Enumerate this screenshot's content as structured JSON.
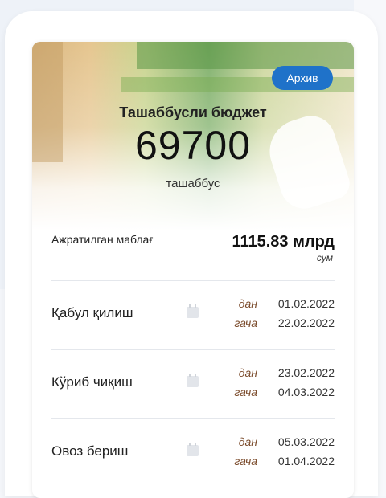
{
  "archive_button": {
    "label": "Архив"
  },
  "hero": {
    "title": "Ташаббусли бюджет",
    "value": "69700",
    "unit": "ташаббус"
  },
  "allocation": {
    "label": "Ажратилган маблағ",
    "value": "1115.83 млрд",
    "unit": "сум"
  },
  "stages": [
    {
      "label": "Қабул қилиш",
      "from_label": "дан",
      "from": "01.02.2022",
      "to_label": "гача",
      "to": "22.02.2022"
    },
    {
      "label": "Кўриб чиқиш",
      "from_label": "дан",
      "from": "23.02.2022",
      "to_label": "гача",
      "to": "04.03.2022"
    },
    {
      "label": "Овоз бериш",
      "from_label": "дан",
      "from": "05.03.2022",
      "to_label": "гача",
      "to": "01.04.2022"
    }
  ],
  "colors": {
    "accent": "#1f72c9"
  },
  "icons": {
    "stage": "calendar-icon"
  }
}
